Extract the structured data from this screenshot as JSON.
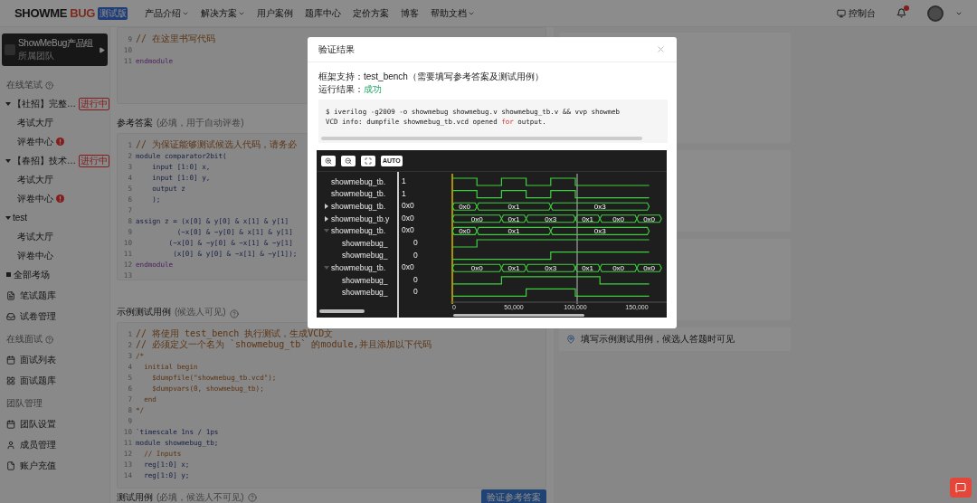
{
  "header": {
    "logo": {
      "text_a": "SHOWME",
      "text_b": "BUG",
      "badge": "测试版"
    },
    "nav": [
      {
        "label": "产品介绍",
        "has_menu": true
      },
      {
        "label": "解决方案",
        "has_menu": true
      },
      {
        "label": "用户案例",
        "has_menu": false
      },
      {
        "label": "题库中心",
        "has_menu": false
      },
      {
        "label": "定价方案",
        "has_menu": false
      },
      {
        "label": "博客",
        "has_menu": false
      },
      {
        "label": "帮助文档",
        "has_menu": true
      }
    ],
    "console": "控制台",
    "unread": true
  },
  "sidebar": {
    "team": {
      "name": "ShowMeBug产品组",
      "subtitle": "所属团队"
    },
    "sections": [
      {
        "title": "在线笔试",
        "help": true,
        "items": [
          {
            "kind": "tree",
            "label": "【社招】完整…",
            "badge": "进行中",
            "expanded": true,
            "children": [
              {
                "label": "考试大厅",
                "alert": false
              },
              {
                "label": "评卷中心",
                "alert": true
              }
            ]
          },
          {
            "kind": "tree",
            "label": "【春招】技术…",
            "badge": "进行中",
            "expanded": true,
            "children": [
              {
                "label": "考试大厅",
                "alert": false
              },
              {
                "label": "评卷中心",
                "alert": true
              }
            ]
          },
          {
            "kind": "tree",
            "label": "test",
            "expanded": true,
            "children": [
              {
                "label": "考试大厅",
                "alert": false
              },
              {
                "label": "评卷中心",
                "alert": false
              }
            ]
          },
          {
            "kind": "square",
            "label": "全部考场"
          },
          {
            "kind": "link",
            "label": "笔试题库"
          },
          {
            "kind": "link",
            "label": "试卷管理"
          }
        ]
      },
      {
        "title": "在线面试",
        "help": true,
        "items": [
          {
            "kind": "link",
            "label": "面试列表"
          },
          {
            "kind": "link",
            "label": "面试题库"
          }
        ]
      },
      {
        "title": "团队管理",
        "help": false,
        "items": [
          {
            "kind": "link",
            "label": "团队设置"
          },
          {
            "kind": "link",
            "label": "成员管理"
          },
          {
            "kind": "link",
            "label": "账户充值"
          }
        ]
      }
    ]
  },
  "editors": [
    {
      "lines": [
        {
          "n": "9",
          "kind": "comment",
          "text": "// 在这里书写代码"
        },
        {
          "n": "10"
        },
        {
          "n": "11",
          "kind": "keyword",
          "text": "endmodule"
        }
      ]
    },
    {
      "label": "参考答案",
      "hint": "(必填，用于自动评卷)",
      "help": false,
      "lines": [
        {
          "n": "1",
          "kind": "comment",
          "text": "// 为保证能够测试候选人代码，请务必"
        },
        {
          "n": "2",
          "kind": "code",
          "text": "module comparator2bit("
        },
        {
          "n": "3",
          "kind": "code",
          "text": "    input [1:0] x,"
        },
        {
          "n": "4",
          "kind": "code",
          "text": "    input [1:0] y,"
        },
        {
          "n": "5",
          "kind": "code",
          "text": "    output z"
        },
        {
          "n": "6",
          "kind": "code",
          "text": "    );"
        },
        {
          "n": "7"
        },
        {
          "n": "8",
          "kind": "code",
          "text": "assign z = (x[0] & y[0] & x[1] & y[1]"
        },
        {
          "n": "9",
          "kind": "code",
          "text": "          (~x[0] & ~y[0] & x[1] & y[1]"
        },
        {
          "n": "10",
          "kind": "code",
          "text": "        (~x[0] & ~y[0] & ~x[1] & ~y[1]"
        },
        {
          "n": "11",
          "kind": "code",
          "text": "         (x[0] & y[0] & ~x[1] & ~y[1]);"
        },
        {
          "n": "12",
          "kind": "keyword",
          "text": "endmodule"
        },
        {
          "n": "13"
        }
      ]
    },
    {
      "label": "示例测试用例",
      "hint": "(候选人可见)",
      "help": true,
      "lines": [
        {
          "n": "1",
          "kind": "comment",
          "text": "// 将使用 test_bench 执行测试，生成VCD文"
        },
        {
          "n": "2",
          "kind": "comment",
          "text": "// 必须定义一个名为 `showmebug_tb` 的module,并且添加以下代码"
        },
        {
          "n": "3",
          "kind": "comment",
          "text": "/*"
        },
        {
          "n": "4",
          "kind": "comment",
          "text": "  initial begin"
        },
        {
          "n": "5",
          "kind": "comment",
          "text": "    $dumpfile(\"showmebug_tb.vcd\");"
        },
        {
          "n": "6",
          "kind": "comment",
          "text": "    $dumpvars(0, showmebug_tb);"
        },
        {
          "n": "7",
          "kind": "comment",
          "text": "  end"
        },
        {
          "n": "8",
          "kind": "comment",
          "text": "*/"
        },
        {
          "n": "9"
        },
        {
          "n": "10",
          "kind": "code",
          "text": "`timescale 1ns / 1ps"
        },
        {
          "n": "11",
          "kind": "code",
          "text": "module showmebug_tb;"
        },
        {
          "n": "12",
          "kind": "comment",
          "text": "  // Inputs"
        },
        {
          "n": "13",
          "kind": "code",
          "text": "  reg[1:0] x;"
        },
        {
          "n": "14",
          "kind": "code",
          "text": "  reg[1:0] y;"
        }
      ]
    }
  ],
  "test_cases": {
    "label": "测试用例",
    "hint": "(必填，候选人不可见)",
    "button": "验证参考答案"
  },
  "right_panel": {
    "hint": "填写示例测试用例，候选人答题时可见"
  },
  "modal": {
    "title": "验证结果",
    "framework_label": "框架支持：",
    "framework": "test_bench（需要填写参考答案及测试用例）",
    "result_label": "运行结果：",
    "result": "成功",
    "output_lines": [
      [
        {
          "text": "$ iverilog -g2009 -o showmebug showmebug.v showmebug_tb.v && vvp showmeb"
        }
      ],
      [
        {
          "text": "VCD info: dumpfile showmebug_tb.vcd opened "
        },
        {
          "text": "for",
          "kind": "keyword"
        },
        {
          "text": " output."
        }
      ]
    ],
    "wave": {
      "auto": "AUTO",
      "ticks": [
        "0",
        "50,000",
        "100,000",
        "150,000"
      ],
      "signals": [
        {
          "name": "showmebug_tb.",
          "value": "1",
          "kind": "bit"
        },
        {
          "name": "showmebug_tb.",
          "value": "1",
          "kind": "bit"
        },
        {
          "name": "showmebug_tb.",
          "value": "0x0",
          "kind": "bus",
          "expanded": false,
          "labels": [
            "0x0",
            "0x1",
            "0x3"
          ]
        },
        {
          "name": "showmebug_tb.y",
          "value": "0x0",
          "kind": "bus",
          "expanded": false,
          "labels": [
            "0x0",
            "0x1",
            "0x3",
            "0x1",
            "0x0",
            "0x0"
          ]
        },
        {
          "name": "showmebug_tb.",
          "value": "0x0",
          "kind": "bus",
          "expanded": true,
          "labels": [
            "0x0",
            "0x1",
            "0x3"
          ],
          "children": [
            {
              "name": "showmebug_",
              "value": "0",
              "kind": "bit"
            },
            {
              "name": "showmebug_",
              "value": "0",
              "kind": "bit"
            }
          ]
        },
        {
          "name": "showmebug_tb.",
          "value": "0x0",
          "kind": "bus",
          "expanded": true,
          "labels": [
            "0x0",
            "0x1",
            "0x3",
            "0x1",
            "0x0",
            "0x0"
          ],
          "children": [
            {
              "name": "showmebug_",
              "value": "0",
              "kind": "bit"
            },
            {
              "name": "showmebug_",
              "value": "0",
              "kind": "bit"
            }
          ]
        }
      ]
    }
  }
}
